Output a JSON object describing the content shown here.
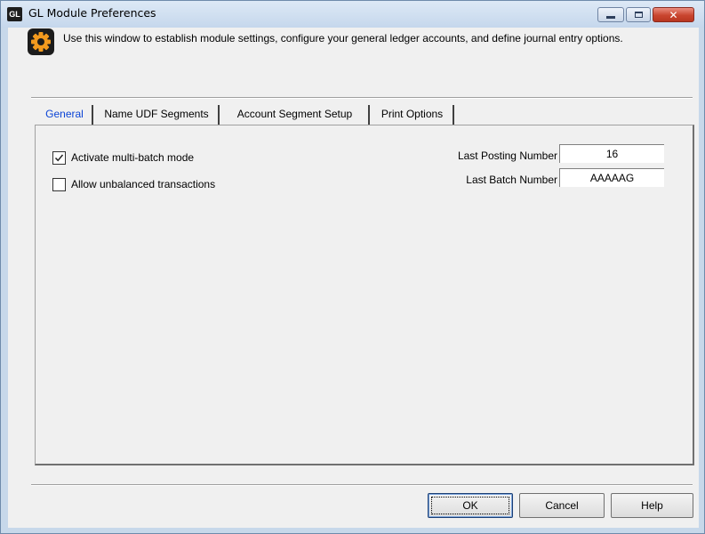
{
  "window": {
    "app_badge": "GL",
    "title": "GL Module Preferences"
  },
  "info": {
    "text": "Use this window to establish module settings, configure your general ledger accounts, and define journal entry options.",
    "icon": "gear-icon"
  },
  "tabs": [
    {
      "label": "General",
      "active": true
    },
    {
      "label": "Name UDF Segments",
      "active": false
    },
    {
      "label": "Account Segment Setup",
      "active": false
    },
    {
      "label": "Print Options",
      "active": false
    }
  ],
  "general": {
    "multi_batch": {
      "label": "Activate multi-batch mode",
      "checked": true
    },
    "unbalanced": {
      "label": "Allow unbalanced transactions",
      "checked": false
    },
    "last_posting": {
      "label": "Last Posting Number",
      "value": "16"
    },
    "last_batch": {
      "label": "Last Batch Number",
      "value": "AAAAAG"
    }
  },
  "buttons": {
    "ok": "OK",
    "cancel": "Cancel",
    "help": "Help"
  },
  "colors": {
    "active_tab": "#0b44d6",
    "icon_orange": "#f39a1e",
    "close_button": "#c9452f"
  }
}
